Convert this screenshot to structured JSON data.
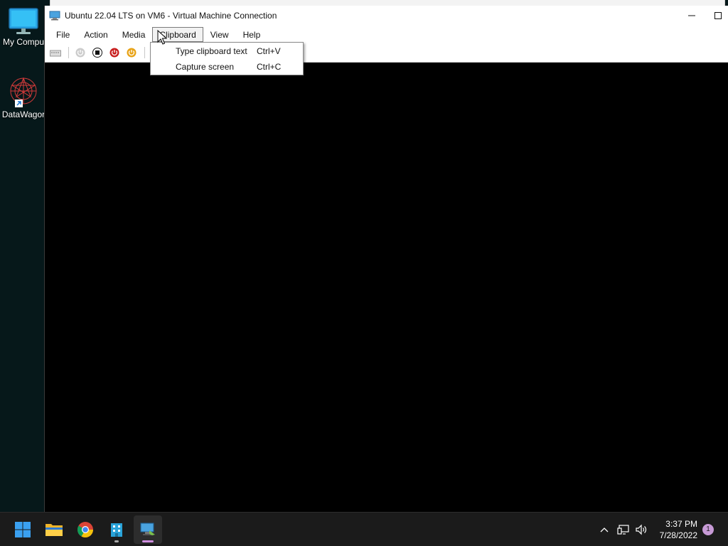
{
  "desktop": {
    "icons": [
      {
        "label": "My Compu",
        "icon": "monitor-icon"
      },
      {
        "label": "DataWagor",
        "icon": "datawagon-shortcut-icon"
      }
    ]
  },
  "window": {
    "title": "Ubuntu 22.04 LTS on VM6 - Virtual Machine Connection",
    "minimize_glyph": "—",
    "maximize_glyph": "☐"
  },
  "menubar": {
    "items": [
      {
        "label": "File"
      },
      {
        "label": "Action"
      },
      {
        "label": "Media"
      },
      {
        "label": "Clipboard",
        "open": true
      },
      {
        "label": "View"
      },
      {
        "label": "Help"
      }
    ]
  },
  "toolbar": {
    "buttons": [
      {
        "icon": "ctrl-alt-del-icon",
        "enabled": false
      },
      {
        "icon": "start-icon",
        "enabled": false
      },
      {
        "icon": "turn-off-icon",
        "color": "#111111"
      },
      {
        "icon": "shut-down-icon",
        "color": "#c81e1e"
      },
      {
        "icon": "save-icon",
        "color": "#e8a317"
      },
      {
        "icon": "pause-icon",
        "color": "#2a7fd4"
      }
    ]
  },
  "clipboard_menu": {
    "items": [
      {
        "label": "Type clipboard text",
        "shortcut": "Ctrl+V"
      },
      {
        "label": "Capture screen",
        "shortcut": "Ctrl+C"
      }
    ]
  },
  "taskbar": {
    "apps": [
      {
        "icon": "windows-start-icon"
      },
      {
        "icon": "file-explorer-icon"
      },
      {
        "icon": "chrome-icon"
      },
      {
        "icon": "database-app-icon",
        "running": true
      },
      {
        "icon": "vm-connection-icon",
        "running": true,
        "active": true
      }
    ],
    "tray": {
      "time": "3:37 PM",
      "date": "7/28/2022",
      "notification_count": "1"
    }
  },
  "colors": {
    "accent": "#0078d4",
    "taskbar_bg": "#1b1b1b",
    "desktop_bg": "#06181a"
  }
}
